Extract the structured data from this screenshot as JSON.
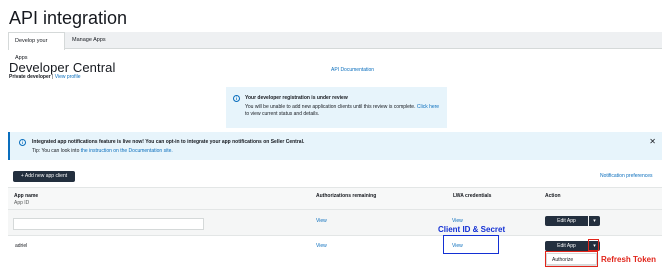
{
  "page": {
    "title": "API integration"
  },
  "tabs": [
    {
      "label": "Develop your Apps",
      "active": true
    },
    {
      "label": "Manage Apps",
      "active": false
    }
  ],
  "developer": {
    "title": "Developer Central",
    "role": "Private developer",
    "view_profile": "View profile",
    "api_doc": "API Documentation"
  },
  "review_notice": {
    "title": "Your developer registration is under review",
    "text_before": "You will be unable to add new application clients until this review is complete.",
    "click_here": "Click here",
    "text_after": "to view current status and details."
  },
  "notification_notice": {
    "title": "Integrated app notifications feature is live now! You can opt-in to integrate your app notifications on Seller Central.",
    "tip_prefix": "Tip: You can look into",
    "tip_link": "the instruction on the Documentation site.",
    "close": "✕"
  },
  "toolbar": {
    "add_label": "+ Add new app client",
    "notif_pref": "Notification preferences"
  },
  "table": {
    "columns": {
      "app_name": "App name",
      "app_id": "App ID",
      "auth": "Authorizations remaining",
      "lwa": "LWA credentials",
      "action": "Action"
    },
    "rows": [
      {
        "name": "",
        "auth": "View",
        "lwa": "View",
        "edit": "Edit App",
        "caret": "▾"
      },
      {
        "name": "adriel",
        "auth": "View",
        "lwa": "View",
        "edit": "Edit App",
        "caret": "▾"
      }
    ],
    "dropdown_item": "Authorize"
  },
  "annotations": {
    "client_secret": "Client ID & Secret",
    "refresh_token": "Refresh Token",
    "blue": "#1330d4",
    "red": "#e1251b"
  },
  "colors": {
    "link": "#0a6ebd",
    "button_dark": "#232f3e",
    "info_bg": "#e7f4fb"
  }
}
